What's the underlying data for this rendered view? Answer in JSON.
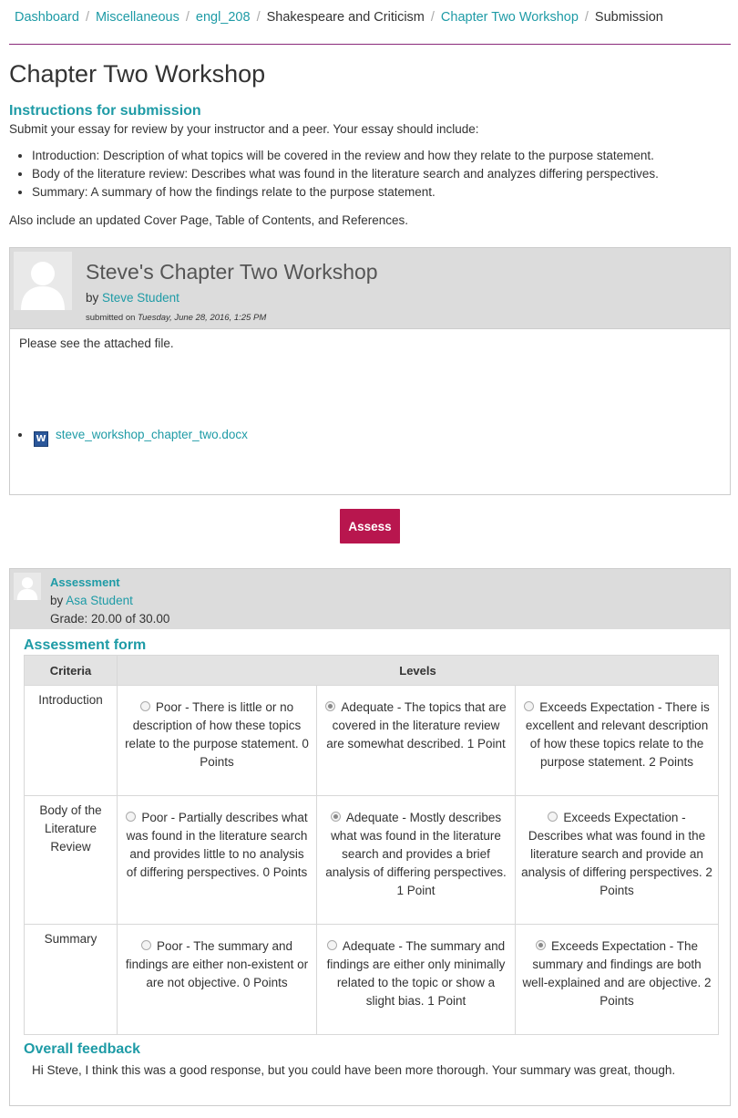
{
  "breadcrumb": [
    {
      "label": "Dashboard",
      "link": true
    },
    {
      "label": "Miscellaneous",
      "link": true
    },
    {
      "label": "engl_208",
      "link": true
    },
    {
      "label": "Shakespeare and Criticism",
      "link": false
    },
    {
      "label": "Chapter Two Workshop",
      "link": true
    },
    {
      "label": "Submission",
      "link": false
    }
  ],
  "page": {
    "title": "Chapter Two Workshop"
  },
  "instructions": {
    "heading": "Instructions for submission",
    "intro": "Submit your essay for review by your instructor and a peer. Your essay should include:",
    "items": [
      "Introduction: Description of what topics will be covered in the review and how they relate to the purpose statement.",
      "Body of the literature review: Describes what was found in the literature search and analyzes differing perspectives.",
      "Summary: A summary of how the findings relate to the purpose statement."
    ],
    "outro": "Also include an updated Cover Page, Table of Contents, and References."
  },
  "submission": {
    "title": "Steve's Chapter Two Workshop",
    "by_prefix": "by",
    "author": "Steve Student",
    "submitted_prefix": "submitted on",
    "submitted_date": "Tuesday, June 28, 2016, 1:25 PM",
    "body": "Please see the attached file.",
    "attachment": "steve_workshop_chapter_two.docx",
    "attachment_icon": "word-doc-icon"
  },
  "assess_button": "Assess",
  "assessment": {
    "title": "Assessment",
    "by_prefix": "by",
    "assessor": "Asa Student",
    "grade": "Grade: 20.00 of 30.00",
    "form_heading": "Assessment form",
    "col_criteria": "Criteria",
    "col_levels": "Levels",
    "rows": [
      {
        "criterion": "Introduction",
        "levels": [
          {
            "text": "Poor - There is little or no description of how these topics relate to the purpose statement. 0 Points",
            "selected": false
          },
          {
            "text": "Adequate - The topics that are covered in the literature review are somewhat described. 1 Point",
            "selected": true
          },
          {
            "text": "Exceeds Expectation - There is excellent and relevant description of how these topics relate to the purpose statement. 2 Points",
            "selected": false
          }
        ]
      },
      {
        "criterion": "Body of the Literature Review",
        "levels": [
          {
            "text": "Poor - Partially describes what was found in the literature search and provides little to no analysis of differing perspectives. 0 Points",
            "selected": false
          },
          {
            "text": "Adequate - Mostly describes what was found in the literature search and provides a brief analysis of differing perspectives. 1 Point",
            "selected": true
          },
          {
            "text": "Exceeds Expectation - Describes what was found in the literature search and provide an analysis of differing perspectives. 2 Points",
            "selected": false
          }
        ]
      },
      {
        "criterion": "Summary",
        "levels": [
          {
            "text": "Poor - The summary and findings are either non-existent or are not objective. 0 Points",
            "selected": false
          },
          {
            "text": "Adequate - The summary and findings are either only minimally related to the topic or show a slight bias. 1 Point",
            "selected": false
          },
          {
            "text": "Exceeds Expectation - The summary and findings are both well-explained and are objective. 2 Points",
            "selected": true
          }
        ]
      }
    ],
    "feedback_heading": "Overall feedback",
    "feedback": "Hi Steve, I think this was a good response, but you could have been more thorough.  Your summary was great, though."
  },
  "colors": {
    "accent": "#1e9ba6",
    "button": "#b8164e",
    "header_bg": "#dcdcdc",
    "rule": "#8a2a7a"
  }
}
